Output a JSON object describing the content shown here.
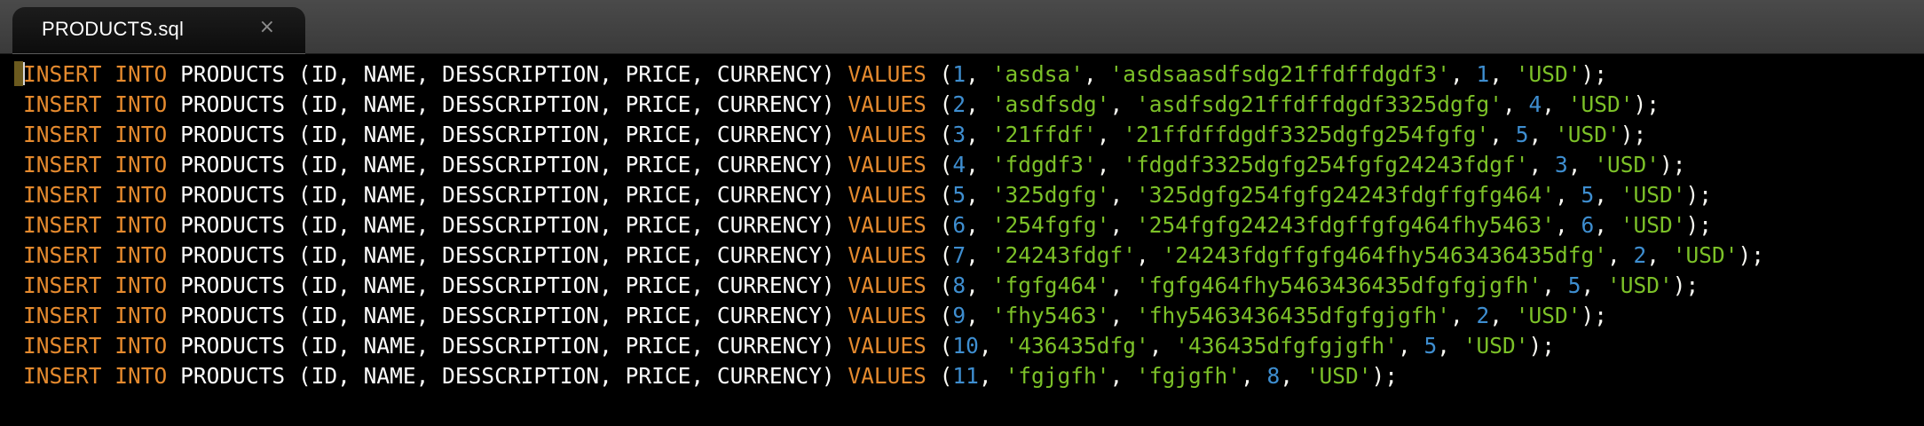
{
  "tab": {
    "title": "PRODUCTS.sql",
    "close_glyph": "×"
  },
  "colors": {
    "keyword": "#e58a2e",
    "number": "#3e8ed0",
    "string": "#7cc128",
    "plain": "#ffffff",
    "background": "#000000"
  },
  "sql": {
    "kw_insert": "INSERT",
    "kw_into": "INTO",
    "table": "PRODUCTS",
    "columns": "(ID, NAME, DESSCRIPTION, PRICE, CURRENCY)",
    "kw_values": "VALUES",
    "rows": [
      {
        "id": "1",
        "name": "'asdsa'",
        "description": "'asdsaasdfsdg21ffdffdgdf3'",
        "price": "1",
        "currency": "'USD'"
      },
      {
        "id": "2",
        "name": "'asdfsdg'",
        "description": "'asdfsdg21ffdffdgdf3325dgfg'",
        "price": "4",
        "currency": "'USD'"
      },
      {
        "id": "3",
        "name": "'21ffdf'",
        "description": "'21ffdffdgdf3325dgfg254fgfg'",
        "price": "5",
        "currency": "'USD'"
      },
      {
        "id": "4",
        "name": "'fdgdf3'",
        "description": "'fdgdf3325dgfg254fgfg24243fdgf'",
        "price": "3",
        "currency": "'USD'"
      },
      {
        "id": "5",
        "name": "'325dgfg'",
        "description": "'325dgfg254fgfg24243fdgffgfg464'",
        "price": "5",
        "currency": "'USD'"
      },
      {
        "id": "6",
        "name": "'254fgfg'",
        "description": "'254fgfg24243fdgffgfg464fhy5463'",
        "price": "6",
        "currency": "'USD'"
      },
      {
        "id": "7",
        "name": "'24243fdgf'",
        "description": "'24243fdgffgfg464fhy5463436435dfg'",
        "price": "2",
        "currency": "'USD'"
      },
      {
        "id": "8",
        "name": "'fgfg464'",
        "description": "'fgfg464fhy5463436435dfgfgjgfh'",
        "price": "5",
        "currency": "'USD'"
      },
      {
        "id": "9",
        "name": "'fhy5463'",
        "description": "'fhy5463436435dfgfgjgfh'",
        "price": "2",
        "currency": "'USD'"
      },
      {
        "id": "10",
        "name": "'436435dfg'",
        "description": "'436435dfgfgjgfh'",
        "price": "5",
        "currency": "'USD'"
      },
      {
        "id": "11",
        "name": "'fgjgfh'",
        "description": "'fgjgfh'",
        "price": "8",
        "currency": "'USD'"
      }
    ]
  }
}
